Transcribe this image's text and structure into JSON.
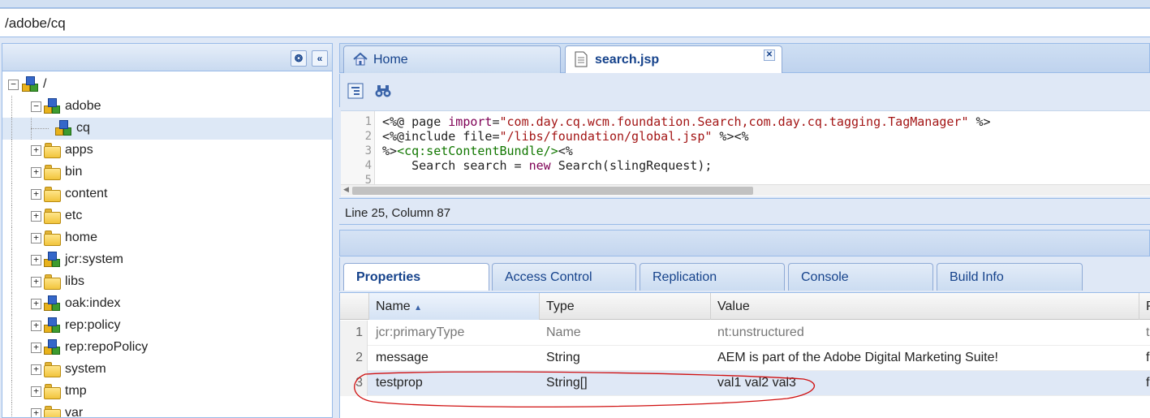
{
  "path": "/adobe/cq",
  "tree": [
    {
      "label": "/",
      "icon": "node",
      "level": 0,
      "expander": "−"
    },
    {
      "label": "adobe",
      "icon": "node",
      "level": 1,
      "expander": "−"
    },
    {
      "label": "cq",
      "icon": "node",
      "level": 2,
      "expander": "",
      "selected": true
    },
    {
      "label": "apps",
      "icon": "folder",
      "level": 1,
      "expander": "+"
    },
    {
      "label": "bin",
      "icon": "folder",
      "level": 1,
      "expander": "+"
    },
    {
      "label": "content",
      "icon": "folder",
      "level": 1,
      "expander": "+"
    },
    {
      "label": "etc",
      "icon": "folder",
      "level": 1,
      "expander": "+"
    },
    {
      "label": "home",
      "icon": "folder",
      "level": 1,
      "expander": "+"
    },
    {
      "label": "jcr:system",
      "icon": "node",
      "level": 1,
      "expander": "+"
    },
    {
      "label": "libs",
      "icon": "folder",
      "level": 1,
      "expander": "+"
    },
    {
      "label": "oak:index",
      "icon": "node",
      "level": 1,
      "expander": "+"
    },
    {
      "label": "rep:policy",
      "icon": "node",
      "level": 1,
      "expander": "+"
    },
    {
      "label": "rep:repoPolicy",
      "icon": "node",
      "level": 1,
      "expander": "+"
    },
    {
      "label": "system",
      "icon": "folder",
      "level": 1,
      "expander": "+"
    },
    {
      "label": "tmp",
      "icon": "folder",
      "level": 1,
      "expander": "+"
    },
    {
      "label": "var",
      "icon": "folder",
      "level": 1,
      "expander": "+"
    }
  ],
  "editor_tabs": [
    {
      "label": "Home",
      "icon": "home-icon"
    },
    {
      "label": "search.jsp",
      "icon": "document-icon",
      "active": true,
      "closable": true
    }
  ],
  "toolbar": {
    "tree_icon": "node-tree-icon",
    "find_icon": "binoculars-icon"
  },
  "code": {
    "line_numbers": [
      "1",
      "2",
      "3",
      "4",
      "5"
    ]
  },
  "status": "Line 25, Column 87",
  "property_tabs": [
    "Properties",
    "Access Control",
    "Replication",
    "Console",
    "Build Info"
  ],
  "grid": {
    "columns": [
      "Name",
      "Type",
      "Value",
      "P"
    ],
    "rows": [
      {
        "num": "1",
        "name": "jcr:primaryType",
        "type": "Name",
        "value": "nt:unstructured",
        "extra": "tr",
        "muted": true
      },
      {
        "num": "2",
        "name": "message",
        "type": "String",
        "value": "AEM is part of the Adobe Digital Marketing Suite!",
        "extra": "fa"
      },
      {
        "num": "3",
        "name": "testprop",
        "type": "String[]",
        "value": "val1 val2 val3",
        "extra": "fa",
        "selected": true
      }
    ]
  },
  "colors": {
    "accent": "#15428b",
    "border": "#99bbe8",
    "annotation": "#d01010"
  }
}
